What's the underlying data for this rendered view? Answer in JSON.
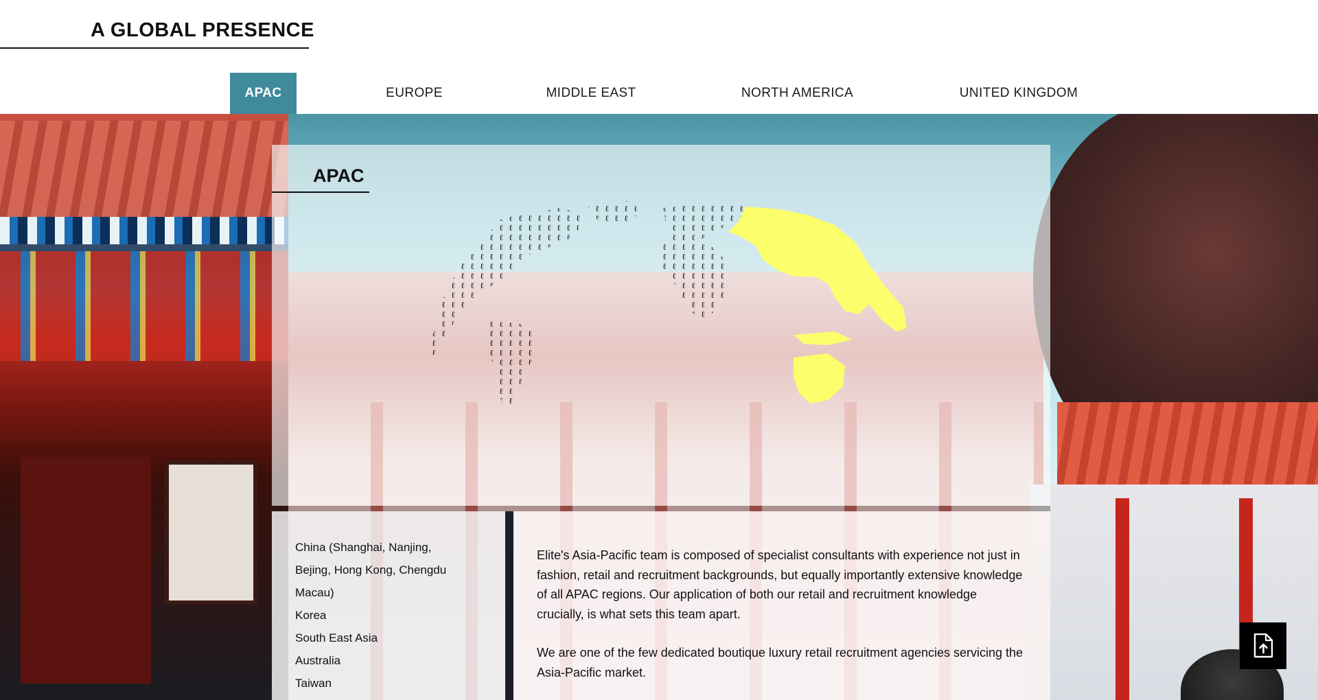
{
  "header": {
    "title": "A GLOBAL PRESENCE"
  },
  "tabs": [
    {
      "label": "APAC",
      "active": true
    },
    {
      "label": "EUROPE",
      "active": false
    },
    {
      "label": "MIDDLE EAST",
      "active": false
    },
    {
      "label": "NORTH AMERICA",
      "active": false
    },
    {
      "label": "UNITED KINGDOM",
      "active": false
    }
  ],
  "region": {
    "title": "APAC",
    "countries": [
      "China (Shanghai, Nanjing,",
      "Bejing, Hong Kong, Chengdu",
      "Macau)",
      "Korea",
      "South East Asia",
      "Australia",
      "Taiwan"
    ],
    "description": [
      "Elite's Asia-Pacific team is composed of specialist consultants with experience not just in fashion, retail and recruitment backgrounds, but equally importantly extensive knowledge of all APAC regions. Our application of both our retail and recruitment knowledge crucially, is what sets this team apart.",
      "We are one of the few dedicated boutique luxury retail recruitment agencies servicing the Asia-Pacific market."
    ]
  },
  "colors": {
    "accent": "#3f8a9b",
    "highlight": "#fcff6c",
    "text": "#111111"
  },
  "icons": {
    "floating_button": "document-upload-icon"
  }
}
